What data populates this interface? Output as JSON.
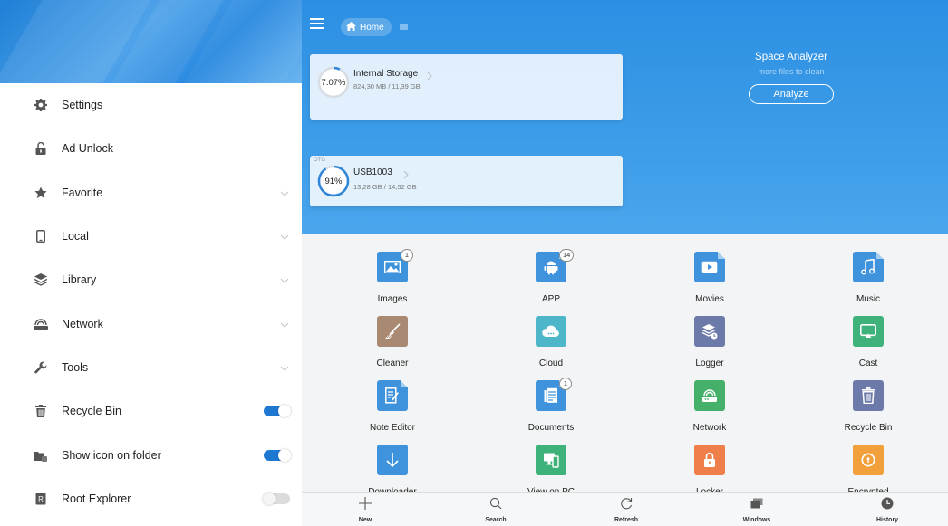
{
  "sidebar": {
    "items": [
      {
        "label": "Settings",
        "icon": "gear-icon"
      },
      {
        "label": "Ad Unlock",
        "icon": "unlock-icon"
      },
      {
        "label": "Favorite",
        "icon": "star-icon"
      },
      {
        "label": "Local",
        "icon": "phone-icon"
      },
      {
        "label": "Library",
        "icon": "layers-icon"
      },
      {
        "label": "Network",
        "icon": "network-icon"
      },
      {
        "label": "Tools",
        "icon": "wrench-icon"
      },
      {
        "label": "Recycle Bin",
        "icon": "trash-icon",
        "toggle": true
      },
      {
        "label": "Show icon on folder",
        "icon": "folder-icon",
        "toggle": true
      },
      {
        "label": "Root Explorer",
        "icon": "root-icon",
        "toggle": false
      }
    ]
  },
  "topbar": {
    "home_label": "Home"
  },
  "storage": {
    "internal": {
      "percent_label": "7.07%",
      "percent": 7.07,
      "title": "Internal Storage",
      "sub": "824,30 MB / 11,39 GB"
    },
    "usb": {
      "tag": "OTG",
      "percent_label": "91%",
      "percent": 91,
      "title": "USB1003",
      "sub": "13,28 GB / 14,52 GB"
    }
  },
  "analyzer": {
    "title": "Space Analyzer",
    "subtitle": "more files to clean",
    "button": "Analyze"
  },
  "apps": [
    {
      "label": "Images",
      "color": "#3f93dc",
      "badge": "1"
    },
    {
      "label": "APP",
      "color": "#3f93dc",
      "badge": "14"
    },
    {
      "label": "Movies",
      "color": "#3f93dc",
      "badge": ""
    },
    {
      "label": "Music",
      "color": "#3f93dc",
      "badge": ""
    },
    {
      "label": "Cleaner",
      "color": "#a98972",
      "badge": ""
    },
    {
      "label": "Cloud",
      "color": "#4db6c9",
      "badge": ""
    },
    {
      "label": "Logger",
      "color": "#6b7aa8",
      "badge": ""
    },
    {
      "label": "Cast",
      "color": "#3eb27a",
      "badge": ""
    },
    {
      "label": "Note Editor",
      "color": "#3f93dc",
      "badge": ""
    },
    {
      "label": "Documents",
      "color": "#3f93dc",
      "badge": "1"
    },
    {
      "label": "Network",
      "color": "#45b06a",
      "badge": ""
    },
    {
      "label": "Recycle Bin",
      "color": "#6b7aa8",
      "badge": ""
    },
    {
      "label": "Downloader",
      "color": "#3f93dc",
      "badge": ""
    },
    {
      "label": "View on PC",
      "color": "#3eb27a",
      "badge": ""
    },
    {
      "label": "Locker",
      "color": "#ef7f4a",
      "badge": ""
    },
    {
      "label": "Encrypted",
      "color": "#f1a03b",
      "badge": ""
    }
  ],
  "toolbar": {
    "new": "New",
    "search": "Search",
    "refresh": "Refresh",
    "windows": "Windows",
    "history": "History"
  }
}
